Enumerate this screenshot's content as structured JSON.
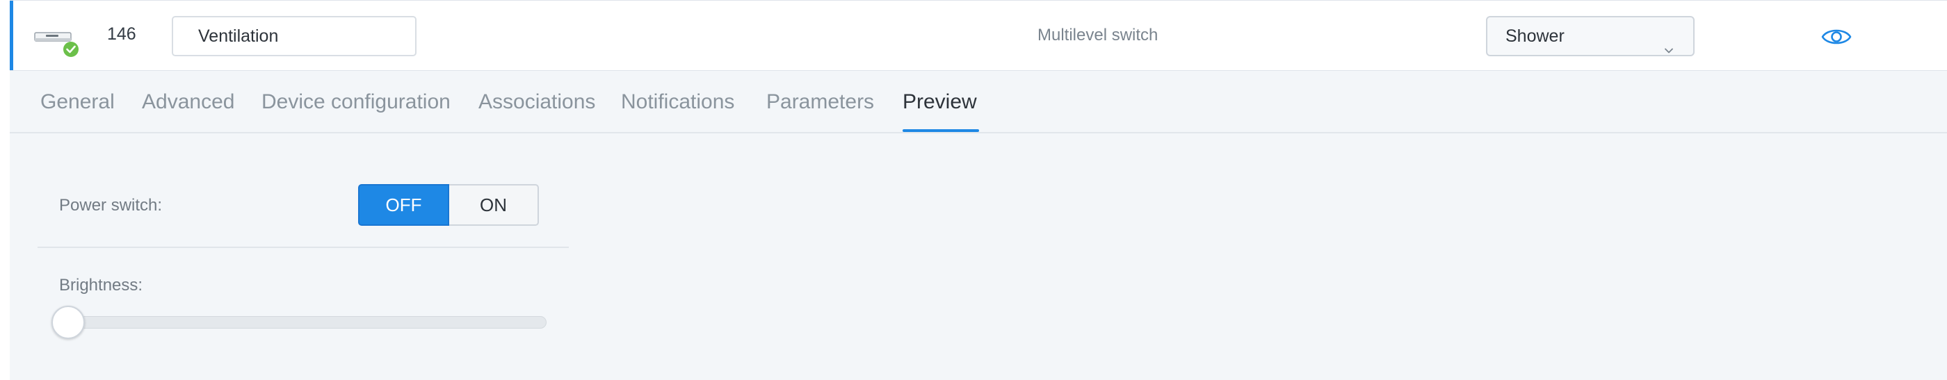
{
  "device": {
    "id": "146",
    "name": "Ventilation",
    "type": "Multilevel switch",
    "room": "Shower",
    "icon": "ventilation-unit-icon",
    "status_icon": "check-badge-icon",
    "visibility_icon": "eye-icon",
    "status_color": "#6cc04a"
  },
  "tabs": [
    {
      "label": "General"
    },
    {
      "label": "Advanced"
    },
    {
      "label": "Device configuration"
    },
    {
      "label": "Associations"
    },
    {
      "label": "Notifications"
    },
    {
      "label": "Parameters"
    },
    {
      "label": "Preview"
    }
  ],
  "active_tab": "Preview",
  "preview": {
    "power_label": "Power switch:",
    "power_off": "OFF",
    "power_on": "ON",
    "power_state": "OFF",
    "brightness_label": "Brightness:",
    "brightness_value": 0
  },
  "colors": {
    "accent": "#1e88e5",
    "background": "#f3f6f9"
  }
}
